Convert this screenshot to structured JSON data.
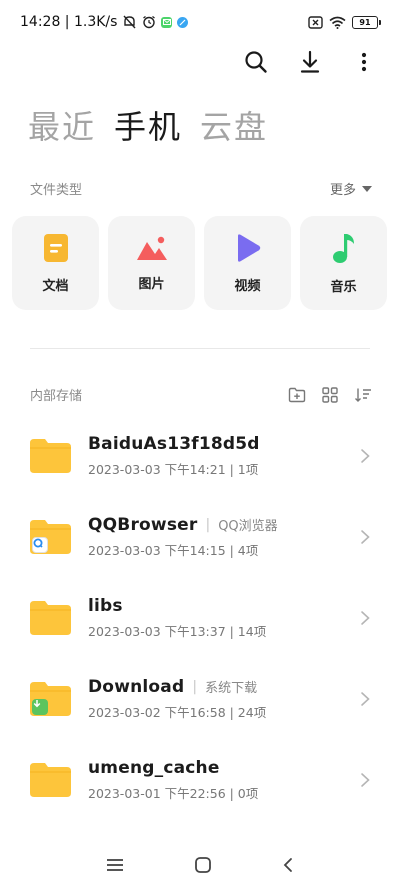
{
  "status_bar": {
    "time_speed": "14:28 | 1.3K/s",
    "battery": "91",
    "colors": {
      "app_green": "#4cd46a",
      "app_blue": "#39a6f2"
    }
  },
  "toolbar": {
    "search_icon": "search-icon",
    "download_icon": "download-icon",
    "more_icon": "more-vertical-icon"
  },
  "title_tabs": [
    {
      "label": "最近",
      "active": false
    },
    {
      "label": "手机",
      "active": true
    },
    {
      "label": "云盘",
      "active": false
    }
  ],
  "file_types": {
    "heading": "文件类型",
    "more_label": "更多",
    "items": [
      {
        "label": "文档",
        "icon": "document-icon",
        "color": "#f7b731"
      },
      {
        "label": "图片",
        "icon": "image-icon",
        "color": "#f45d5d"
      },
      {
        "label": "视频",
        "icon": "video-play-icon",
        "color": "#7a6cf0"
      },
      {
        "label": "音乐",
        "icon": "music-note-icon",
        "color": "#2ecc71"
      }
    ]
  },
  "storage": {
    "heading": "内部存储",
    "files": [
      {
        "name": "BaiduAs13f18d5d",
        "alias": "",
        "meta": "2023-03-03 下午14:21 | 1项",
        "badge": ""
      },
      {
        "name": "QQBrowser",
        "alias": "QQ浏览器",
        "meta": "2023-03-03 下午14:15 | 4项",
        "badge": "qqbrowser"
      },
      {
        "name": "libs",
        "alias": "",
        "meta": "2023-03-03 下午13:37 | 14项",
        "badge": ""
      },
      {
        "name": "Download",
        "alias": "系统下载",
        "meta": "2023-03-02 下午16:58 | 24项",
        "badge": "download"
      },
      {
        "name": "umeng_cache",
        "alias": "",
        "meta": "2023-03-01 下午22:56 | 0项",
        "badge": ""
      }
    ],
    "separator": "|"
  },
  "colors": {
    "folder": "#fdc53b",
    "folder_tab": "#f5b21f"
  }
}
